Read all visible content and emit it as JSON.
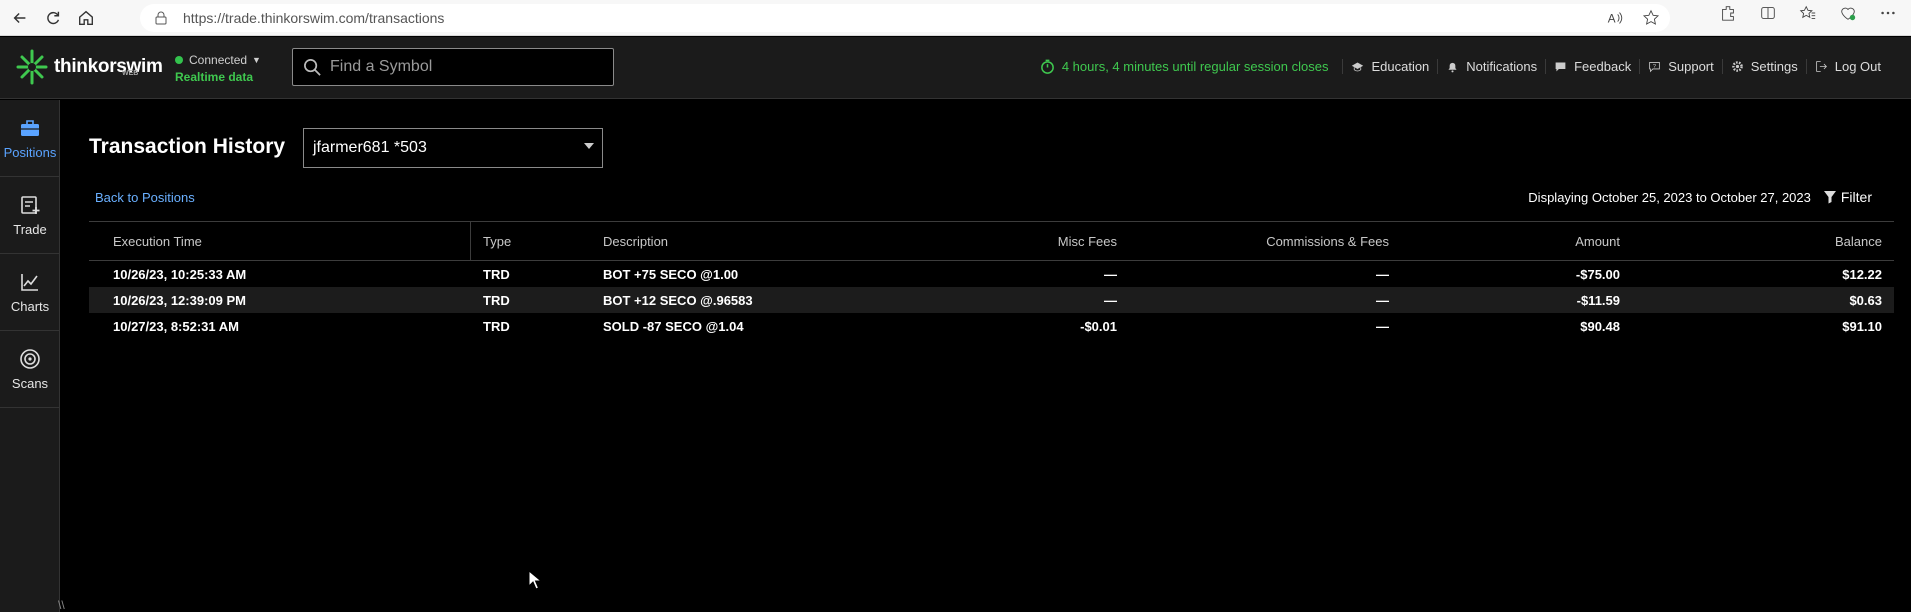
{
  "browser": {
    "url": "https://trade.thinkorswim.com/transactions"
  },
  "header": {
    "logo_text": "thinkorswim",
    "logo_sub": "WEB",
    "connection_status": "Connected",
    "connection_sub": "Realtime data",
    "search_placeholder": "Find a Symbol",
    "session_notice": "4 hours, 4 minutes until regular session closes",
    "menu": {
      "education": "Education",
      "notifications": "Notifications",
      "feedback": "Feedback",
      "support": "Support",
      "settings": "Settings",
      "logout": "Log Out"
    }
  },
  "sidebar": {
    "items": [
      {
        "label": "Positions",
        "icon": "briefcase-icon",
        "active": true
      },
      {
        "label": "Trade",
        "icon": "trade-icon",
        "active": false
      },
      {
        "label": "Charts",
        "icon": "chart-icon",
        "active": false
      },
      {
        "label": "Scans",
        "icon": "target-icon",
        "active": false
      }
    ]
  },
  "main": {
    "title": "Transaction History",
    "account": "jfarmer681 *503",
    "back_link": "Back to Positions",
    "display_range": "Displaying October 25, 2023 to October 27, 2023",
    "filter_label": "Filter"
  },
  "table": {
    "headers": {
      "time": "Execution Time",
      "type": "Type",
      "desc": "Description",
      "misc": "Misc Fees",
      "comm": "Commissions & Fees",
      "amount": "Amount",
      "balance": "Balance"
    },
    "rows": [
      {
        "time": "10/26/23, 10:25:33 AM",
        "type": "TRD",
        "desc": "BOT +75 SECO @1.00",
        "misc": "—",
        "comm": "—",
        "amount": "-$75.00",
        "balance": "$12.22"
      },
      {
        "time": "10/26/23, 12:39:09 PM",
        "type": "TRD",
        "desc": "BOT +12 SECO @.96583",
        "misc": "—",
        "comm": "—",
        "amount": "-$11.59",
        "balance": "$0.63"
      },
      {
        "time": "10/27/23, 8:52:31 AM",
        "type": "TRD",
        "desc": "SOLD -87 SECO @1.04",
        "misc": "-$0.01",
        "comm": "—",
        "amount": "$90.48",
        "balance": "$91.10"
      }
    ]
  },
  "colors": {
    "accent_green": "#3fc84f",
    "link_blue": "#6ab0ff",
    "active_blue": "#5aa3ff"
  }
}
